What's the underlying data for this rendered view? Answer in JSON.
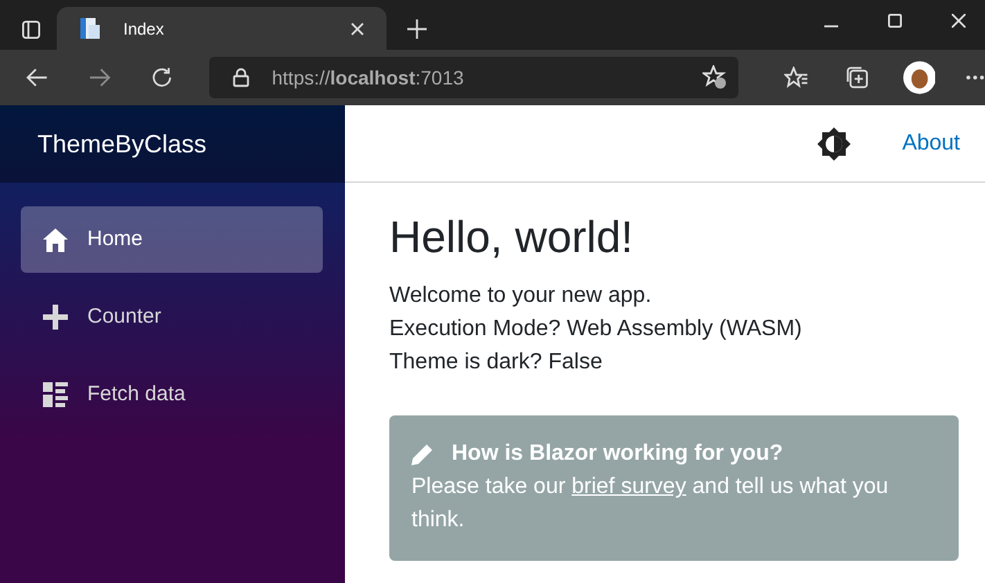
{
  "browser": {
    "tab_title": "Index",
    "url": "https://**localhost**:7013"
  },
  "sidebar": {
    "brand": "ThemeByClass",
    "items": [
      {
        "label": "Home",
        "selected": true
      },
      {
        "label": "Counter",
        "selected": false
      },
      {
        "label": "Fetch data",
        "selected": false
      }
    ]
  },
  "top_bar": {
    "link": "About"
  },
  "page": {
    "heading": "Hello, world!",
    "lines": [
      "Welcome to your new app.",
      "Execution Mode? Web Assembly (WASM)",
      "Theme is dark? False"
    ],
    "survey": {
      "title": "How is Blazor working for you?",
      "before": "Please take our",
      "link": "brief survey",
      "after": "and tell us what you think."
    }
  }
}
